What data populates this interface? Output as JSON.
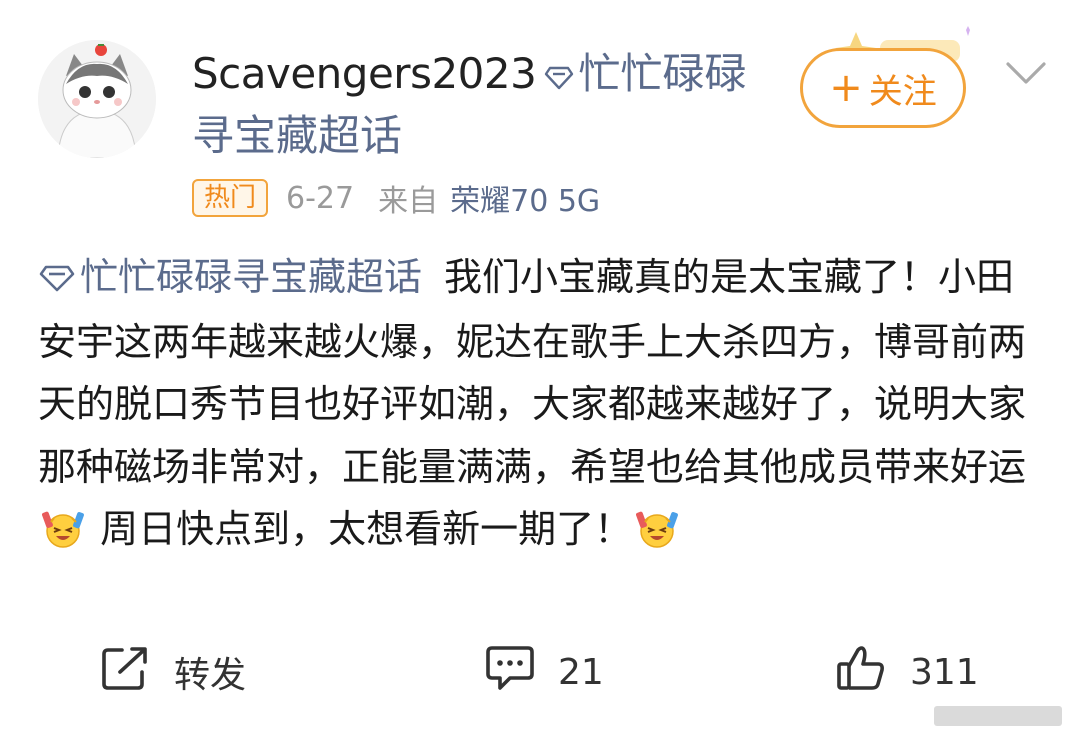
{
  "post": {
    "username": "Scavengers2023",
    "topic_tag": "忙忙碌碌寻宝藏超话",
    "follow_label": "关注",
    "follow_plus": "+",
    "hot_badge": "热门",
    "date": "6-27",
    "from_label": "来自",
    "device": "荣耀70 5G",
    "text_topic": "忙忙碌碌寻宝藏超话",
    "text_part1": "我们小宝藏真的是太宝藏了！小田安宇这两年越来越火爆，妮达在歌手上大杀四方，博哥前两天的脱口秀节目也好评如潮，大家都越来越好了，说明大家那种磁场非常对，正能量满满，希望也给其他成员带来好运",
    "text_part2": " 周日快点到，太想看新一期了！"
  },
  "actions": {
    "repost_label": "转发",
    "comment_count": "21",
    "like_count": "311"
  },
  "icons": {
    "topic": "diamond-icon",
    "follow_deco": "sparkle-decoration-icon",
    "more": "chevron-down-icon",
    "emoji": "cheering-emoji-icon",
    "repost": "share-arrow-icon",
    "comment": "comment-bubble-icon",
    "like": "thumbs-up-icon"
  },
  "colors": {
    "topic_blue": "#5b6b8c",
    "accent_orange": "#f08a1c",
    "badge_border": "#f2a43c",
    "meta_gray": "#9a9a9a"
  }
}
